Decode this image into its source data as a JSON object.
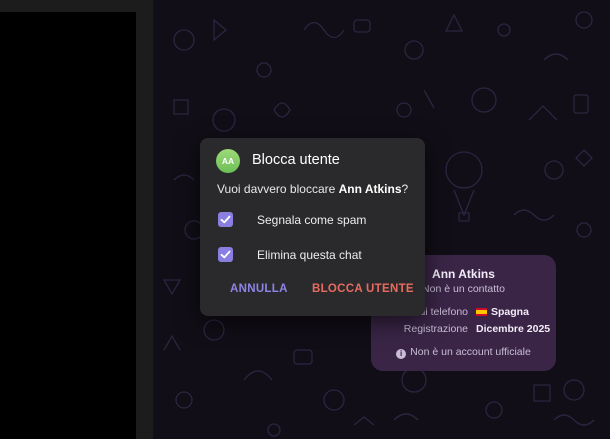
{
  "dialog": {
    "avatar_initials": "AA",
    "title": "Blocca utente",
    "question_prefix": "Vuoi davvero bloccare ",
    "question_name": "Ann Atkins",
    "question_suffix": "?",
    "options": [
      {
        "label": "Segnala come spam",
        "checked": true
      },
      {
        "label": "Elimina questa chat",
        "checked": true
      }
    ],
    "cancel_label": "ANNULLA",
    "block_label": "BLOCCA UTENTE"
  },
  "info_card": {
    "name": "Ann Atkins",
    "status": "Non è un contatto",
    "phone_key": "Numero di telefono",
    "phone_value": "Spagna",
    "registration_key": "Registrazione",
    "registration_value": "Dicembre 2025",
    "note": "Non è un account ufficiale"
  },
  "colors": {
    "accent": "#8a7fe0",
    "danger": "#e96b5f",
    "card": "#3a2547",
    "avatar": "#7cc95e"
  }
}
